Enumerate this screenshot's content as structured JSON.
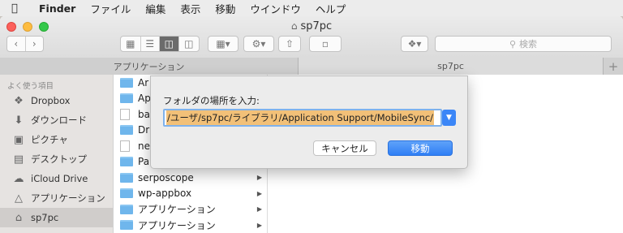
{
  "menubar": {
    "app_name": "Finder",
    "items": [
      "ファイル",
      "編集",
      "表示",
      "移動",
      "ウインドウ",
      "ヘルプ"
    ]
  },
  "window": {
    "title": "sp7pc",
    "search_placeholder": "検索",
    "tabs": [
      "アプリケーション",
      "sp7pc"
    ]
  },
  "sidebar": {
    "header": "よく使う項目",
    "items": [
      {
        "label": "Dropbox",
        "icon": "dropbox-icon"
      },
      {
        "label": "ダウンロード",
        "icon": "download-icon"
      },
      {
        "label": "ピクチャ",
        "icon": "camera-icon"
      },
      {
        "label": "デスクトップ",
        "icon": "desktop-icon"
      },
      {
        "label": "iCloud Drive",
        "icon": "cloud-icon"
      },
      {
        "label": "アプリケーション",
        "icon": "applications-icon"
      },
      {
        "label": "sp7pc",
        "icon": "home-icon"
      }
    ]
  },
  "files": [
    {
      "name": "Ar",
      "type": "folder"
    },
    {
      "name": "Ap",
      "type": "folder"
    },
    {
      "name": "ba",
      "type": "document"
    },
    {
      "name": "Dr",
      "type": "folder"
    },
    {
      "name": "ne",
      "type": "document"
    },
    {
      "name": "Pa",
      "type": "folder"
    },
    {
      "name": "serposcope",
      "type": "folder"
    },
    {
      "name": "wp-appbox",
      "type": "folder"
    },
    {
      "name": "アプリケーション",
      "type": "folder"
    },
    {
      "name": "アプリケーション",
      "type": "folder"
    }
  ],
  "dialog": {
    "label": "フォルダの場所を入力:",
    "path_value": "/ユーザ/sp7pc/ライブラリ/Application Support/MobileSync/",
    "cancel_label": "キャンセル",
    "move_label": "移動"
  }
}
